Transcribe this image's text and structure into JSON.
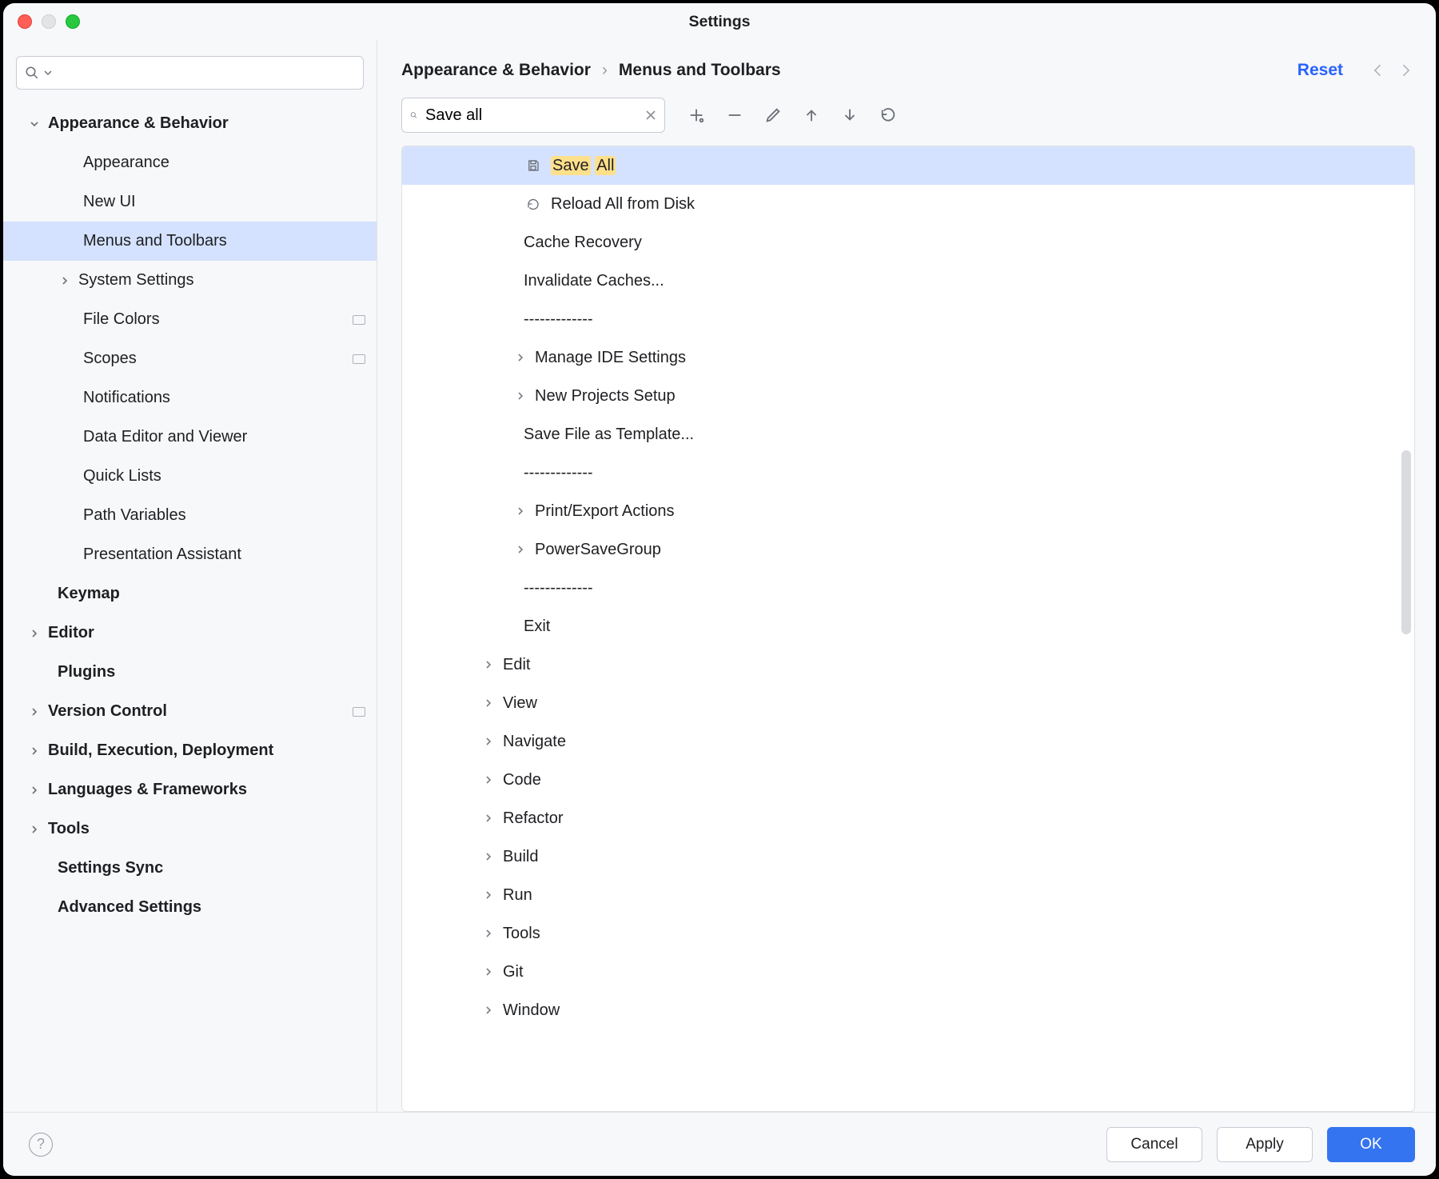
{
  "window_title": "Settings",
  "sidebar_search": {
    "value": "",
    "placeholder": ""
  },
  "sidebar": [
    {
      "label": "Appearance & Behavior",
      "bold": true,
      "expandable": true,
      "expanded": true,
      "level": 0
    },
    {
      "label": "Appearance",
      "level": 1
    },
    {
      "label": "New UI",
      "level": 1
    },
    {
      "label": "Menus and Toolbars",
      "level": 1,
      "selected": true
    },
    {
      "label": "System Settings",
      "level": 1,
      "expandable": true,
      "expanded": false
    },
    {
      "label": "File Colors",
      "level": 1,
      "badge": true
    },
    {
      "label": "Scopes",
      "level": 1,
      "badge": true
    },
    {
      "label": "Notifications",
      "level": 1
    },
    {
      "label": "Data Editor and Viewer",
      "level": 1
    },
    {
      "label": "Quick Lists",
      "level": 1
    },
    {
      "label": "Path Variables",
      "level": 1
    },
    {
      "label": "Presentation Assistant",
      "level": 1
    },
    {
      "label": "Keymap",
      "bold": true,
      "level": 0
    },
    {
      "label": "Editor",
      "bold": true,
      "expandable": true,
      "level": 0
    },
    {
      "label": "Plugins",
      "bold": true,
      "level": 0
    },
    {
      "label": "Version Control",
      "bold": true,
      "expandable": true,
      "level": 0,
      "badge": true
    },
    {
      "label": "Build, Execution, Deployment",
      "bold": true,
      "expandable": true,
      "level": 0
    },
    {
      "label": "Languages & Frameworks",
      "bold": true,
      "expandable": true,
      "level": 0
    },
    {
      "label": "Tools",
      "bold": true,
      "expandable": true,
      "level": 0
    },
    {
      "label": "Settings Sync",
      "bold": true,
      "level": 0
    },
    {
      "label": "Advanced Settings",
      "bold": true,
      "level": 0
    }
  ],
  "breadcrumb": {
    "root": "Appearance & Behavior",
    "sep": "›",
    "leaf": "Menus and Toolbars"
  },
  "reset_label": "Reset",
  "filter": {
    "value": "Save all"
  },
  "toolbar_icons": [
    "add",
    "remove",
    "edit",
    "up",
    "down",
    "restore"
  ],
  "tree": [
    {
      "label_raw": "<span class='hl'>Save</span> <span class='hl'>All</span>",
      "level": 2,
      "icon": "save",
      "selected": true
    },
    {
      "label": "Reload All from Disk",
      "level": 2,
      "icon": "reload"
    },
    {
      "label": "Cache Recovery",
      "level": 2
    },
    {
      "label": "Invalidate Caches...",
      "level": 2
    },
    {
      "label": "-------------",
      "level": 2
    },
    {
      "label": "Manage IDE Settings",
      "level": 2,
      "expandable": true
    },
    {
      "label": "New Projects Setup",
      "level": 2,
      "expandable": true
    },
    {
      "label": "Save File as Template...",
      "level": 2
    },
    {
      "label": "-------------",
      "level": 2
    },
    {
      "label": "Print/Export Actions",
      "level": 2,
      "expandable": true
    },
    {
      "label": "PowerSaveGroup",
      "level": 2,
      "expandable": true
    },
    {
      "label": "-------------",
      "level": 2
    },
    {
      "label": "Exit",
      "level": 2
    },
    {
      "label": "Edit",
      "level": 1,
      "expandable": true
    },
    {
      "label": "View",
      "level": 1,
      "expandable": true
    },
    {
      "label": "Navigate",
      "level": 1,
      "expandable": true
    },
    {
      "label": "Code",
      "level": 1,
      "expandable": true
    },
    {
      "label": "Refactor",
      "level": 1,
      "expandable": true
    },
    {
      "label": "Build",
      "level": 1,
      "expandable": true
    },
    {
      "label": "Run",
      "level": 1,
      "expandable": true
    },
    {
      "label": "Tools",
      "level": 1,
      "expandable": true
    },
    {
      "label": "Git",
      "level": 1,
      "expandable": true
    },
    {
      "label": "Window",
      "level": 1,
      "expandable": true
    }
  ],
  "footer": {
    "cancel": "Cancel",
    "apply": "Apply",
    "ok": "OK"
  }
}
